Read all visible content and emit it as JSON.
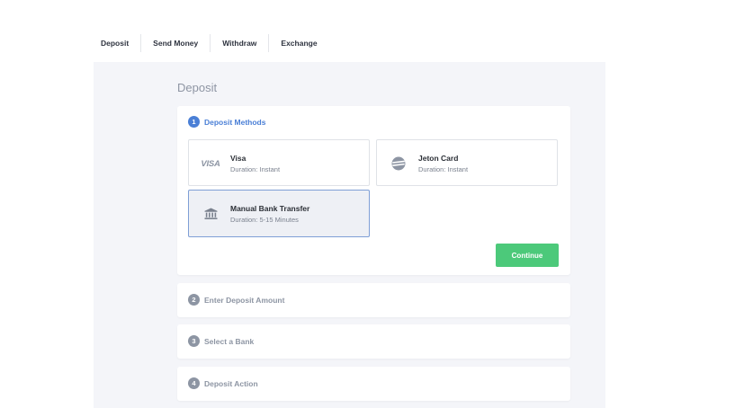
{
  "topnav": {
    "items": [
      {
        "label": "Deposit"
      },
      {
        "label": "Send Money"
      },
      {
        "label": "Withdraw"
      },
      {
        "label": "Exchange"
      }
    ]
  },
  "page": {
    "title": "Deposit"
  },
  "steps": [
    {
      "number": "1",
      "label": "Deposit Methods",
      "active": true
    },
    {
      "number": "2",
      "label": "Enter Deposit Amount",
      "active": false
    },
    {
      "number": "3",
      "label": "Select a Bank",
      "active": false
    },
    {
      "number": "4",
      "label": "Deposit Action",
      "active": false
    }
  ],
  "methods": [
    {
      "name": "Visa",
      "duration": "Duration: Instant",
      "icon": "visa-logo",
      "logo_text": "VISA",
      "selected": false
    },
    {
      "name": "Jeton Card",
      "duration": "Duration: Instant",
      "icon": "jeton-icon",
      "selected": false
    },
    {
      "name": "Manual Bank Transfer",
      "duration": "Duration: 5-15 Minutes",
      "icon": "bank-icon",
      "selected": true
    }
  ],
  "actions": {
    "continue_label": "Continue"
  },
  "colors": {
    "accent": "#4a7fd6",
    "continue": "#4cc97a",
    "panel_bg": "#f4f5f9",
    "muted": "#8d95a3"
  }
}
